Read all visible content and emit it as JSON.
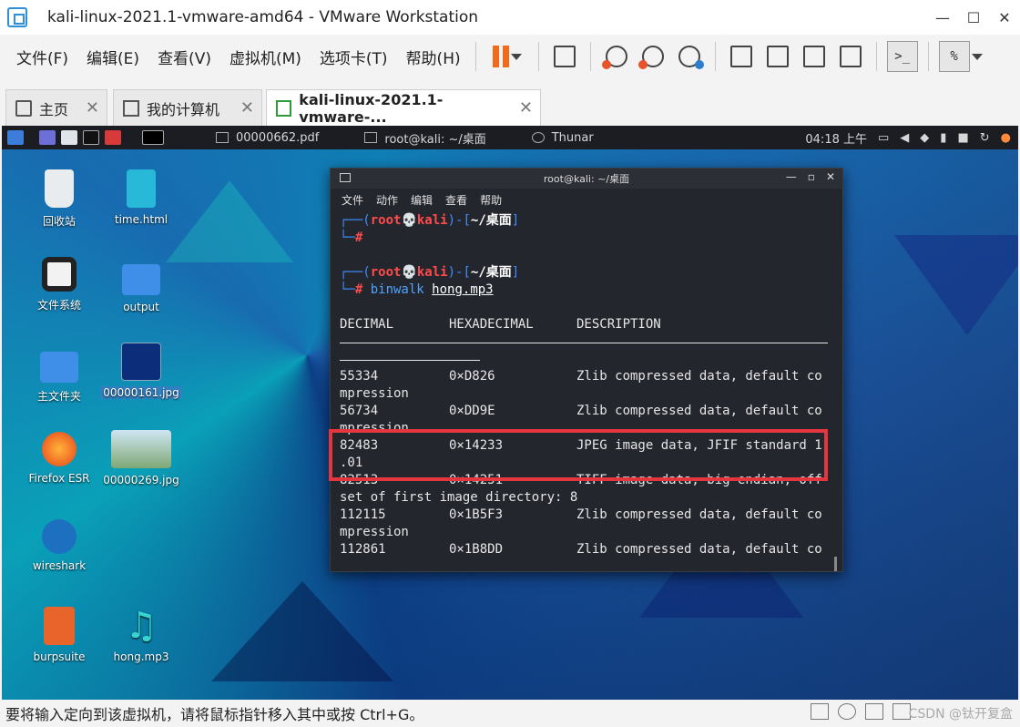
{
  "window": {
    "title": "kali-linux-2021.1-vmware-amd64 - VMware Workstation",
    "minimize": "—",
    "maximize": "☐",
    "close": "✕"
  },
  "menu": [
    "文件(F)",
    "编辑(E)",
    "查看(V)",
    "虚拟机(M)",
    "选项卡(T)",
    "帮助(H)"
  ],
  "toolbar": {
    "console_label": ">_",
    "view_label": "%"
  },
  "tabs": [
    {
      "label": "主页",
      "close": "✕"
    },
    {
      "label": "我的计算机",
      "close": "✕"
    },
    {
      "label": "kali-linux-2021.1-vmware-...",
      "close": "✕"
    }
  ],
  "guest": {
    "topbar": {
      "task1": "00000662.pdf",
      "task2": "root@kali: ~/桌面",
      "task3": "Thunar",
      "clock": "04:18 上午"
    },
    "desktop_icons": [
      "回收站",
      "time.html",
      "文件系统",
      "output",
      "主文件夹",
      "00000161.jpg",
      "Firefox ESR",
      "00000269.jpg",
      "wireshark",
      "burpsuite",
      "hong.mp3"
    ],
    "terminal": {
      "title": "root@kali: ~/桌面",
      "menu": [
        "文件",
        "动作",
        "编辑",
        "查看",
        "帮助"
      ],
      "prompt_user": "root",
      "prompt_host": "kali",
      "prompt_dir": "~/桌面",
      "command": "binwalk",
      "command_arg": "hong.mp3",
      "headers": [
        "DECIMAL",
        "HEXADECIMAL",
        "DESCRIPTION"
      ],
      "rows": [
        {
          "dec": "55334",
          "hex": "0×D826",
          "desc": "Zlib compressed data, default co",
          "cont": "mpression"
        },
        {
          "dec": "56734",
          "hex": "0×DD9E",
          "desc": "Zlib compressed data, default co",
          "cont": "mpression"
        },
        {
          "dec": "82483",
          "hex": "0×14233",
          "desc": "JPEG image data, JFIF standard 1",
          "cont": ".01"
        },
        {
          "dec": "82513",
          "hex": "0×14251",
          "desc": "TIFF image data, big-endian, off",
          "cont": "set of first image directory: 8"
        },
        {
          "dec": "112115",
          "hex": "0×1B5F3",
          "desc": "Zlib compressed data, default co",
          "cont": "mpression"
        },
        {
          "dec": "112861",
          "hex": "0×1B8DD",
          "desc": "Zlib compressed data, default co",
          "cont": ""
        }
      ]
    }
  },
  "status": {
    "message": "要将输入定向到该虚拟机，请将鼠标指针移入其中或按 Ctrl+G。",
    "watermark": "CSDN @钛开复盒"
  },
  "colors": {
    "pause": "#f26b1d",
    "highlight": "#e53640",
    "terminal_bg": "#23262d"
  }
}
